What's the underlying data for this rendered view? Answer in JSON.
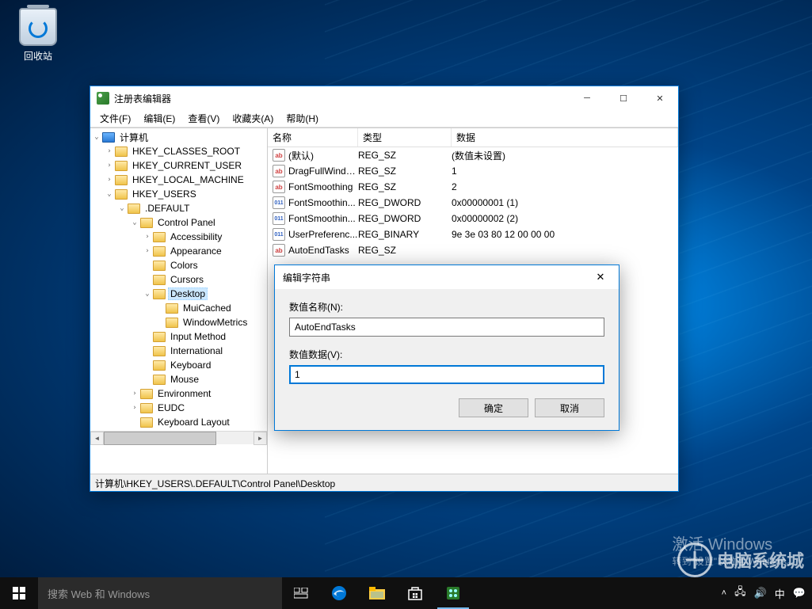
{
  "desktop": {
    "recycle_bin": "回收站"
  },
  "regedit": {
    "title": "注册表编辑器",
    "menu": {
      "file": "文件(F)",
      "edit": "编辑(E)",
      "view": "查看(V)",
      "favorites": "收藏夹(A)",
      "help": "帮助(H)"
    },
    "tree": {
      "root": "计算机",
      "hives": [
        "HKEY_CLASSES_ROOT",
        "HKEY_CURRENT_USER",
        "HKEY_LOCAL_MACHINE",
        "HKEY_USERS"
      ],
      "default_key": ".DEFAULT",
      "control_panel": "Control Panel",
      "cp_children": [
        "Accessibility",
        "Appearance",
        "Colors",
        "Cursors",
        "Desktop",
        "Input Method",
        "International",
        "Keyboard",
        "Mouse"
      ],
      "desktop_children": [
        "MuiCached",
        "WindowMetrics"
      ],
      "after_cp": [
        "Environment",
        "EUDC",
        "Keyboard Layout"
      ]
    },
    "list": {
      "headers": {
        "name": "名称",
        "type": "类型",
        "data": "数据"
      },
      "rows": [
        {
          "name": "(默认)",
          "type": "REG_SZ",
          "data": "(数值未设置)",
          "icon": "sz"
        },
        {
          "name": "DragFullWindo...",
          "type": "REG_SZ",
          "data": "1",
          "icon": "sz"
        },
        {
          "name": "FontSmoothing",
          "type": "REG_SZ",
          "data": "2",
          "icon": "sz"
        },
        {
          "name": "FontSmoothin...",
          "type": "REG_DWORD",
          "data": "0x00000001 (1)",
          "icon": "bin"
        },
        {
          "name": "FontSmoothin...",
          "type": "REG_DWORD",
          "data": "0x00000002 (2)",
          "icon": "bin"
        },
        {
          "name": "UserPreferenc...",
          "type": "REG_BINARY",
          "data": "9e 3e 03 80 12 00 00 00",
          "icon": "bin"
        },
        {
          "name": "AutoEndTasks",
          "type": "REG_SZ",
          "data": "",
          "icon": "sz"
        }
      ]
    },
    "status": "计算机\\HKEY_USERS\\.DEFAULT\\Control Panel\\Desktop"
  },
  "dialog": {
    "title": "编辑字符串",
    "name_label": "数值名称(N):",
    "name_value": "AutoEndTasks",
    "data_label": "数值数据(V):",
    "data_value": "1",
    "ok": "确定",
    "cancel": "取消"
  },
  "watermark": {
    "title": "激活 Windows",
    "sub": "转到\"设置\"以激活 Windows。"
  },
  "logo_text": "电脑系统城",
  "taskbar": {
    "search_placeholder": "搜索 Web 和 Windows"
  }
}
